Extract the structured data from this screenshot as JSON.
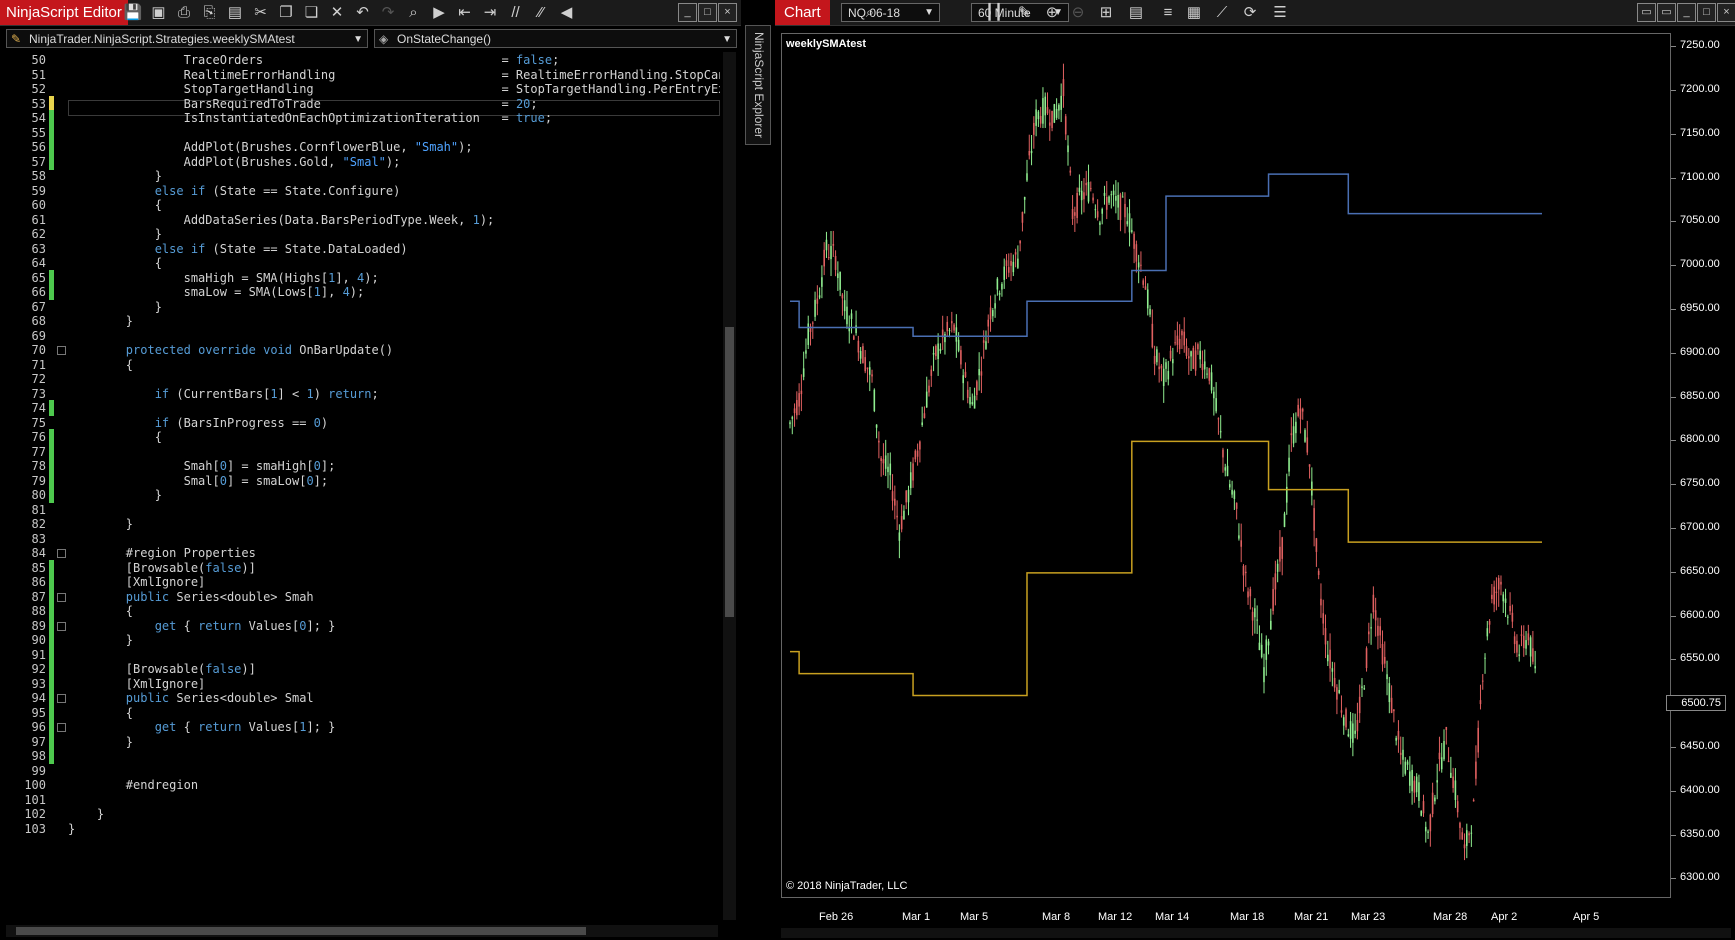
{
  "editor": {
    "title": "NinjaScript Editor",
    "toolbar_icons": [
      "save-icon",
      "save-all-icon",
      "print-icon",
      "print-preview-icon",
      "template-icon",
      "cut-icon",
      "copy-icon",
      "paste-icon",
      "delete-icon",
      "undo-icon",
      "redo-icon",
      "find-icon",
      "compile-icon",
      "outdent-icon",
      "indent-icon",
      "comment-icon",
      "uncomment-icon",
      "visual-studio-icon"
    ],
    "class_combo": "NinjaTrader.NinjaScript.Strategies.weeklySMAtest",
    "member_combo": "OnStateChange()",
    "lines": [
      {
        "n": "50",
        "t": "                TraceOrders                                 = false;",
        "c": false
      },
      {
        "n": "51",
        "t": "                RealtimeErrorHandling                       = RealtimeErrorHandling.StopCance",
        "c": false
      },
      {
        "n": "52",
        "t": "                StopTargetHandling                          = StopTargetHandling.PerEntryExec",
        "c": false
      },
      {
        "n": "53",
        "t": "                BarsRequiredToTrade                         = 20;",
        "c": "y"
      },
      {
        "n": "54",
        "t": "                IsInstantiatedOnEachOptimizationIteration   = true;",
        "c": true
      },
      {
        "n": "55",
        "t": "",
        "c": true
      },
      {
        "n": "56",
        "t": "                AddPlot(Brushes.CornflowerBlue, \"Smah\");",
        "c": true
      },
      {
        "n": "57",
        "t": "                AddPlot(Brushes.Gold, \"Smal\");",
        "c": true
      },
      {
        "n": "58",
        "t": "            }",
        "c": false
      },
      {
        "n": "59",
        "t": "            else if (State == State.Configure)",
        "c": false
      },
      {
        "n": "60",
        "t": "            {",
        "c": false
      },
      {
        "n": "61",
        "t": "                AddDataSeries(Data.BarsPeriodType.Week, 1);",
        "c": false
      },
      {
        "n": "62",
        "t": "            }",
        "c": false
      },
      {
        "n": "63",
        "t": "            else if (State == State.DataLoaded)",
        "c": false
      },
      {
        "n": "64",
        "t": "            {",
        "c": false
      },
      {
        "n": "65",
        "t": "                smaHigh = SMA(Highs[1], 4);",
        "c": true
      },
      {
        "n": "66",
        "t": "                smaLow = SMA(Lows[1], 4);",
        "c": true
      },
      {
        "n": "67",
        "t": "            }",
        "c": false
      },
      {
        "n": "68",
        "t": "        }",
        "c": false
      },
      {
        "n": "69",
        "t": "",
        "c": false
      },
      {
        "n": "70",
        "t": "        protected override void OnBarUpdate()",
        "c": false
      },
      {
        "n": "71",
        "t": "        {",
        "c": false
      },
      {
        "n": "72",
        "t": "",
        "c": false
      },
      {
        "n": "73",
        "t": "            if (CurrentBars[1] < 1) return;",
        "c": false
      },
      {
        "n": "74",
        "t": "",
        "c": true
      },
      {
        "n": "75",
        "t": "            if (BarsInProgress == 0)",
        "c": false
      },
      {
        "n": "76",
        "t": "            {",
        "c": true
      },
      {
        "n": "77",
        "t": "",
        "c": true
      },
      {
        "n": "78",
        "t": "                Smah[0] = smaHigh[0];",
        "c": true
      },
      {
        "n": "79",
        "t": "                Smal[0] = smaLow[0];",
        "c": true
      },
      {
        "n": "80",
        "t": "            }",
        "c": true
      },
      {
        "n": "81",
        "t": "",
        "c": false
      },
      {
        "n": "82",
        "t": "        }",
        "c": false
      },
      {
        "n": "83",
        "t": "",
        "c": false
      },
      {
        "n": "84",
        "t": "        #region Properties",
        "c": false
      },
      {
        "n": "85",
        "t": "        [Browsable(false)]",
        "c": true
      },
      {
        "n": "86",
        "t": "        [XmlIgnore]",
        "c": true
      },
      {
        "n": "87",
        "t": "        public Series<double> Smah",
        "c": true
      },
      {
        "n": "88",
        "t": "        {",
        "c": true
      },
      {
        "n": "89",
        "t": "            get { return Values[0]; }",
        "c": true
      },
      {
        "n": "90",
        "t": "        }",
        "c": true
      },
      {
        "n": "91",
        "t": "",
        "c": true
      },
      {
        "n": "92",
        "t": "        [Browsable(false)]",
        "c": true
      },
      {
        "n": "93",
        "t": "        [XmlIgnore]",
        "c": true
      },
      {
        "n": "94",
        "t": "        public Series<double> Smal",
        "c": true
      },
      {
        "n": "95",
        "t": "        {",
        "c": true
      },
      {
        "n": "96",
        "t": "            get { return Values[1]; }",
        "c": true
      },
      {
        "n": "97",
        "t": "        }",
        "c": true
      },
      {
        "n": "98",
        "t": "",
        "c": true
      },
      {
        "n": "99",
        "t": "",
        "c": false
      },
      {
        "n": "100",
        "t": "        #endregion",
        "c": false
      },
      {
        "n": "101",
        "t": "",
        "c": false
      },
      {
        "n": "102",
        "t": "    }",
        "c": false
      },
      {
        "n": "103",
        "t": "}",
        "c": false
      }
    ],
    "fold_lines": [
      "70",
      "84",
      "87",
      "89",
      "94",
      "96"
    ]
  },
  "explorer_tab": "NinjaScript Explorer",
  "chart": {
    "title": "Chart",
    "instrument": "NQ 06-18",
    "interval": "60 Minute",
    "toolbar_icons": [
      "search-icon",
      "bar-type-icon",
      "draw-icon",
      "zoom-in-icon",
      "zoom-out-icon",
      "crosshair-icon",
      "properties-icon",
      "indicators-icon",
      "strategies-icon",
      "drawing-tools-icon",
      "reload-icon",
      "more-icon"
    ],
    "strategy_label": "weeklySMAtest",
    "copyright": "© 2018 NinjaTrader, LLC",
    "current_price": "6500.75",
    "colors": {
      "up": "#90ee90",
      "down": "#e06060",
      "smah": "#4a6fb3",
      "smal": "#c8a020",
      "axis": "#666666"
    }
  },
  "chart_data": {
    "type": "line",
    "ylim": [
      6280,
      7265
    ],
    "y_ticks": [
      "7250.00",
      "7200.00",
      "7150.00",
      "7100.00",
      "7050.00",
      "7000.00",
      "6950.00",
      "6900.00",
      "6850.00",
      "6800.00",
      "6750.00",
      "6700.00",
      "6650.00",
      "6600.00",
      "6550.00",
      "6500.00",
      "6450.00",
      "6400.00",
      "6350.00",
      "6300.00"
    ],
    "x_ticks": [
      "Feb 26",
      "Mar 1",
      "Mar 5",
      "Mar 8",
      "Mar 12",
      "Mar 14",
      "Mar 18",
      "Mar 21",
      "Mar 23",
      "Mar 28",
      "Apr 2",
      "Apr 5"
    ],
    "x_range": [
      0,
      330
    ],
    "price_x": [
      0,
      4,
      8,
      12,
      16,
      20,
      24,
      28,
      32,
      36,
      40,
      44,
      48,
      52,
      56,
      60,
      64,
      68,
      72,
      76,
      80,
      84,
      88,
      92,
      96,
      100,
      104,
      108,
      112,
      116,
      120,
      124,
      128,
      132,
      136,
      140,
      144,
      148,
      152,
      156,
      160,
      164,
      168,
      172,
      176,
      180,
      184,
      188,
      192,
      196,
      200,
      204,
      208,
      212,
      216,
      220,
      224,
      228,
      232,
      236,
      240,
      244,
      248,
      252,
      256,
      260,
      264,
      268,
      272,
      276,
      280,
      284,
      288,
      292,
      296,
      300,
      304,
      308,
      312,
      316,
      320,
      324,
      328
    ],
    "price_y": [
      6820,
      6850,
      6920,
      6960,
      7020,
      7010,
      6950,
      6930,
      6900,
      6870,
      6780,
      6760,
      6700,
      6740,
      6790,
      6850,
      6900,
      6920,
      6930,
      6880,
      6840,
      6890,
      6950,
      6980,
      7000,
      7010,
      7100,
      7170,
      7180,
      7170,
      7200,
      7060,
      7080,
      7090,
      7060,
      7080,
      7070,
      7060,
      7020,
      6980,
      6900,
      6870,
      6900,
      6920,
      6890,
      6900,
      6880,
      6820,
      6760,
      6720,
      6640,
      6600,
      6540,
      6620,
      6680,
      6800,
      6840,
      6780,
      6640,
      6560,
      6520,
      6480,
      6460,
      6530,
      6620,
      6560,
      6500,
      6440,
      6420,
      6400,
      6350,
      6420,
      6460,
      6400,
      6330,
      6380,
      6540,
      6620,
      6640,
      6600,
      6560,
      6580,
      6520
    ],
    "series": [
      {
        "name": "Smah",
        "color": "#4a6fb3",
        "x": [
          0,
          4,
          4,
          54,
          54,
          104,
          104,
          150,
          150,
          165,
          165,
          210,
          210,
          245,
          245,
          330
        ],
        "y": [
          6960,
          6960,
          6930,
          6930,
          6920,
          6920,
          6960,
          6960,
          6995,
          6995,
          7080,
          7080,
          7105,
          7105,
          7060,
          7060
        ]
      },
      {
        "name": "Smal",
        "color": "#c8a020",
        "x": [
          0,
          4,
          4,
          54,
          54,
          104,
          104,
          150,
          150,
          165,
          165,
          210,
          210,
          245,
          245,
          330
        ],
        "y": [
          6560,
          6560,
          6535,
          6535,
          6510,
          6510,
          6650,
          6650,
          6800,
          6800,
          6800,
          6800,
          6745,
          6745,
          6685,
          6685
        ]
      }
    ]
  }
}
